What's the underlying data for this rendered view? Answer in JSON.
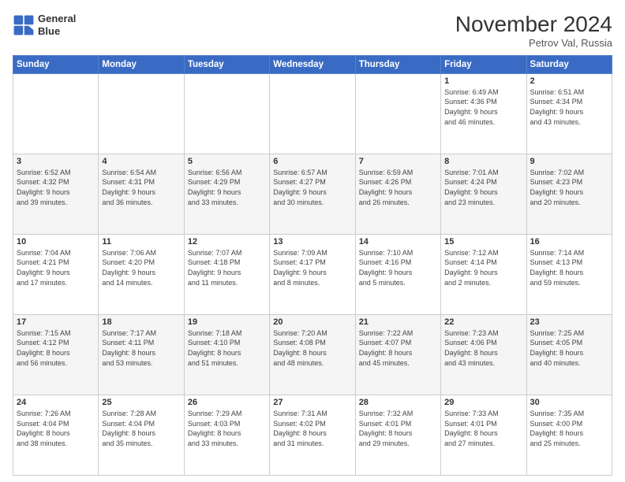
{
  "logo": {
    "line1": "General",
    "line2": "Blue"
  },
  "title": "November 2024",
  "location": "Petrov Val, Russia",
  "weekdays": [
    "Sunday",
    "Monday",
    "Tuesday",
    "Wednesday",
    "Thursday",
    "Friday",
    "Saturday"
  ],
  "weeks": [
    [
      {
        "day": "",
        "info": ""
      },
      {
        "day": "",
        "info": ""
      },
      {
        "day": "",
        "info": ""
      },
      {
        "day": "",
        "info": ""
      },
      {
        "day": "",
        "info": ""
      },
      {
        "day": "1",
        "info": "Sunrise: 6:49 AM\nSunset: 4:36 PM\nDaylight: 9 hours\nand 46 minutes."
      },
      {
        "day": "2",
        "info": "Sunrise: 6:51 AM\nSunset: 4:34 PM\nDaylight: 9 hours\nand 43 minutes."
      }
    ],
    [
      {
        "day": "3",
        "info": "Sunrise: 6:52 AM\nSunset: 4:32 PM\nDaylight: 9 hours\nand 39 minutes."
      },
      {
        "day": "4",
        "info": "Sunrise: 6:54 AM\nSunset: 4:31 PM\nDaylight: 9 hours\nand 36 minutes."
      },
      {
        "day": "5",
        "info": "Sunrise: 6:56 AM\nSunset: 4:29 PM\nDaylight: 9 hours\nand 33 minutes."
      },
      {
        "day": "6",
        "info": "Sunrise: 6:57 AM\nSunset: 4:27 PM\nDaylight: 9 hours\nand 30 minutes."
      },
      {
        "day": "7",
        "info": "Sunrise: 6:59 AM\nSunset: 4:26 PM\nDaylight: 9 hours\nand 26 minutes."
      },
      {
        "day": "8",
        "info": "Sunrise: 7:01 AM\nSunset: 4:24 PM\nDaylight: 9 hours\nand 23 minutes."
      },
      {
        "day": "9",
        "info": "Sunrise: 7:02 AM\nSunset: 4:23 PM\nDaylight: 9 hours\nand 20 minutes."
      }
    ],
    [
      {
        "day": "10",
        "info": "Sunrise: 7:04 AM\nSunset: 4:21 PM\nDaylight: 9 hours\nand 17 minutes."
      },
      {
        "day": "11",
        "info": "Sunrise: 7:06 AM\nSunset: 4:20 PM\nDaylight: 9 hours\nand 14 minutes."
      },
      {
        "day": "12",
        "info": "Sunrise: 7:07 AM\nSunset: 4:18 PM\nDaylight: 9 hours\nand 11 minutes."
      },
      {
        "day": "13",
        "info": "Sunrise: 7:09 AM\nSunset: 4:17 PM\nDaylight: 9 hours\nand 8 minutes."
      },
      {
        "day": "14",
        "info": "Sunrise: 7:10 AM\nSunset: 4:16 PM\nDaylight: 9 hours\nand 5 minutes."
      },
      {
        "day": "15",
        "info": "Sunrise: 7:12 AM\nSunset: 4:14 PM\nDaylight: 9 hours\nand 2 minutes."
      },
      {
        "day": "16",
        "info": "Sunrise: 7:14 AM\nSunset: 4:13 PM\nDaylight: 8 hours\nand 59 minutes."
      }
    ],
    [
      {
        "day": "17",
        "info": "Sunrise: 7:15 AM\nSunset: 4:12 PM\nDaylight: 8 hours\nand 56 minutes."
      },
      {
        "day": "18",
        "info": "Sunrise: 7:17 AM\nSunset: 4:11 PM\nDaylight: 8 hours\nand 53 minutes."
      },
      {
        "day": "19",
        "info": "Sunrise: 7:18 AM\nSunset: 4:10 PM\nDaylight: 8 hours\nand 51 minutes."
      },
      {
        "day": "20",
        "info": "Sunrise: 7:20 AM\nSunset: 4:08 PM\nDaylight: 8 hours\nand 48 minutes."
      },
      {
        "day": "21",
        "info": "Sunrise: 7:22 AM\nSunset: 4:07 PM\nDaylight: 8 hours\nand 45 minutes."
      },
      {
        "day": "22",
        "info": "Sunrise: 7:23 AM\nSunset: 4:06 PM\nDaylight: 8 hours\nand 43 minutes."
      },
      {
        "day": "23",
        "info": "Sunrise: 7:25 AM\nSunset: 4:05 PM\nDaylight: 8 hours\nand 40 minutes."
      }
    ],
    [
      {
        "day": "24",
        "info": "Sunrise: 7:26 AM\nSunset: 4:04 PM\nDaylight: 8 hours\nand 38 minutes."
      },
      {
        "day": "25",
        "info": "Sunrise: 7:28 AM\nSunset: 4:04 PM\nDaylight: 8 hours\nand 35 minutes."
      },
      {
        "day": "26",
        "info": "Sunrise: 7:29 AM\nSunset: 4:03 PM\nDaylight: 8 hours\nand 33 minutes."
      },
      {
        "day": "27",
        "info": "Sunrise: 7:31 AM\nSunset: 4:02 PM\nDaylight: 8 hours\nand 31 minutes."
      },
      {
        "day": "28",
        "info": "Sunrise: 7:32 AM\nSunset: 4:01 PM\nDaylight: 8 hours\nand 29 minutes."
      },
      {
        "day": "29",
        "info": "Sunrise: 7:33 AM\nSunset: 4:01 PM\nDaylight: 8 hours\nand 27 minutes."
      },
      {
        "day": "30",
        "info": "Sunrise: 7:35 AM\nSunset: 4:00 PM\nDaylight: 8 hours\nand 25 minutes."
      }
    ]
  ]
}
